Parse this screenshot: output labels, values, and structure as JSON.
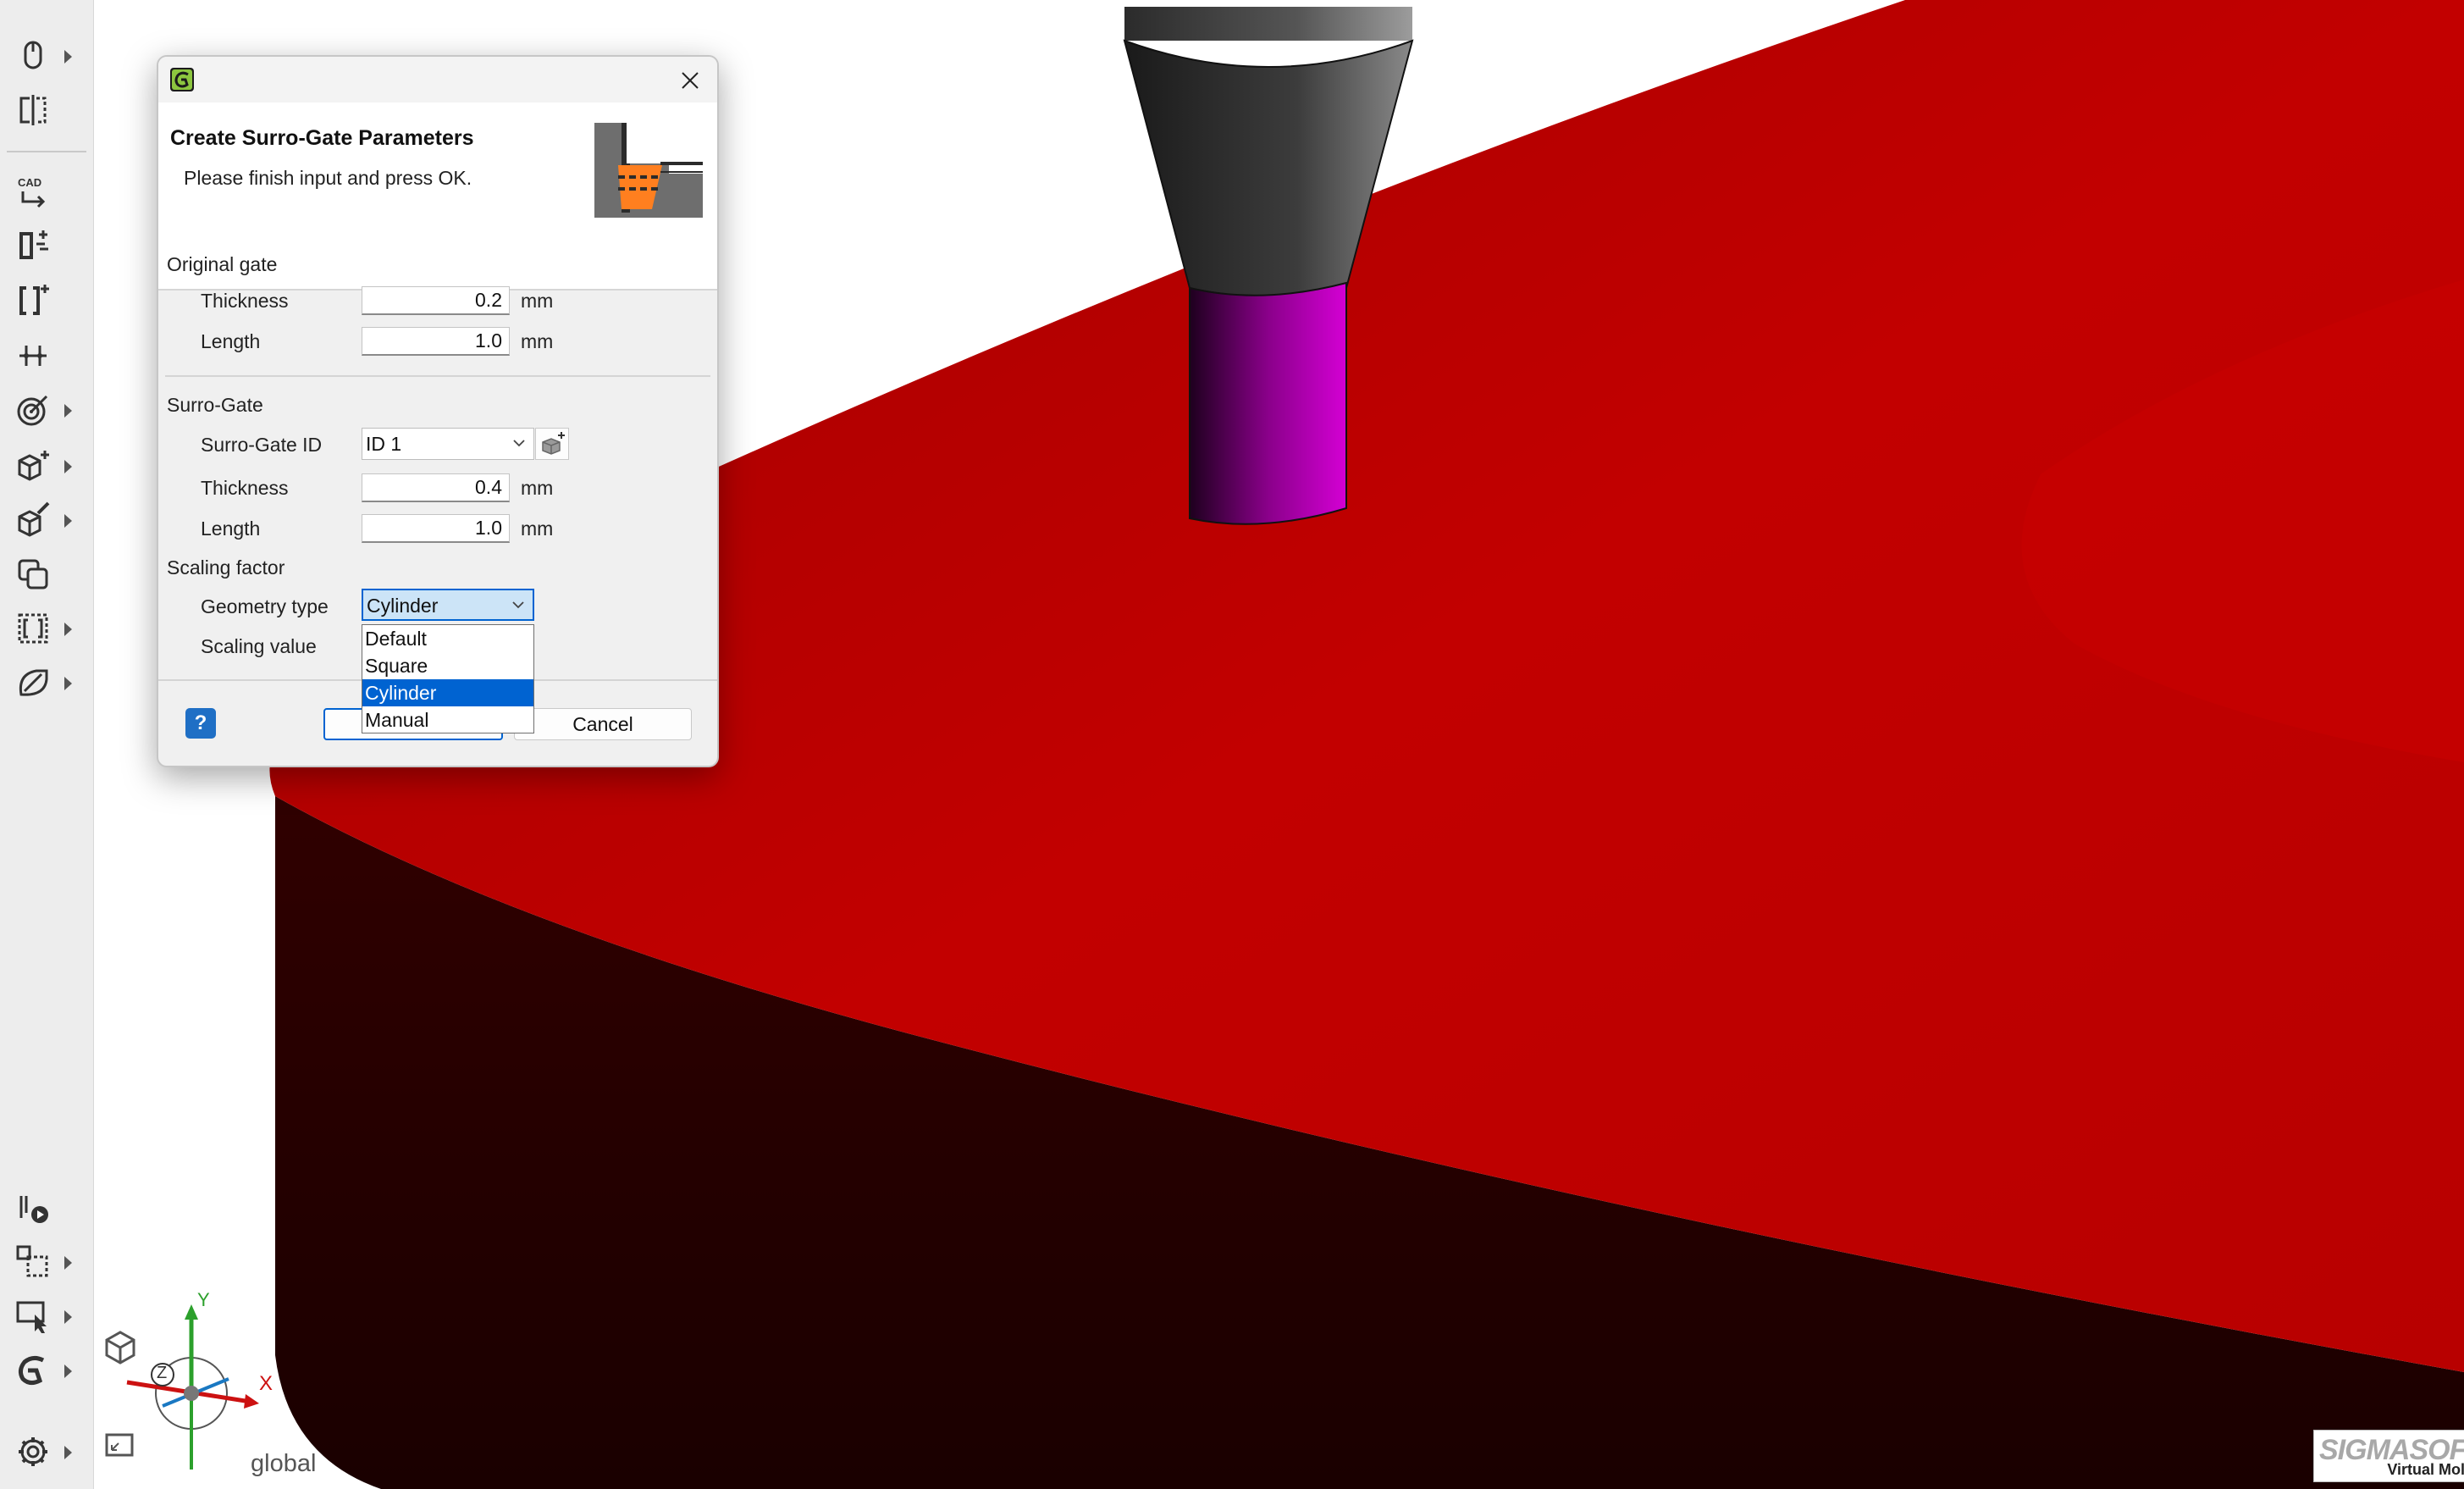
{
  "toolbar": {
    "buttons": [
      "mouse-icon",
      "mirror-split-icon",
      "cad-import-icon",
      "gate-add-icon",
      "gate-insert-icon",
      "move-points-icon",
      "target-icon",
      "add-cube-icon",
      "edit-cube-icon",
      "copy-layers-icon",
      "dashed-part-icon",
      "pen-shape-icon",
      "play-sim-icon",
      "transform-icon",
      "pointer-select-icon",
      "sigmasoft-icon",
      "settings-icon"
    ]
  },
  "dialog": {
    "heading": "Create Surro-Gate Parameters",
    "subheading": "Please finish input and press OK.",
    "original_gate": {
      "group_label": "Original gate",
      "thickness_label": "Thickness",
      "thickness_value": "0.2",
      "length_label": "Length",
      "length_value": "1.0",
      "unit": "mm"
    },
    "surro_gate": {
      "group_label": "Surro-Gate",
      "id_label": "Surro-Gate ID",
      "id_value": "ID 1",
      "thickness_label": "Thickness",
      "thickness_value": "0.4",
      "length_label": "Length",
      "length_value": "1.0",
      "unit": "mm"
    },
    "scaling": {
      "group_label": "Scaling factor",
      "geometry_label": "Geometry type",
      "geometry_value": "Cylinder",
      "scaling_label": "Scaling value",
      "options": [
        "Default",
        "Square",
        "Cylinder",
        "Manual"
      ],
      "selected": "Cylinder"
    },
    "buttons": {
      "ok": "",
      "cancel": "Cancel",
      "help": "?"
    }
  },
  "axis_indicator": {
    "x": "X",
    "y": "Y",
    "z": "Z",
    "label": "global"
  },
  "logo": {
    "brand": "SIGMASOFT",
    "tagline": "Virtual Molding"
  },
  "colors": {
    "accent": "#0063d1",
    "part_top": "#c00000",
    "part_side": "#200000",
    "gate_magenta": "#c800c8",
    "nozzle_gray": "#3a3a3a"
  }
}
